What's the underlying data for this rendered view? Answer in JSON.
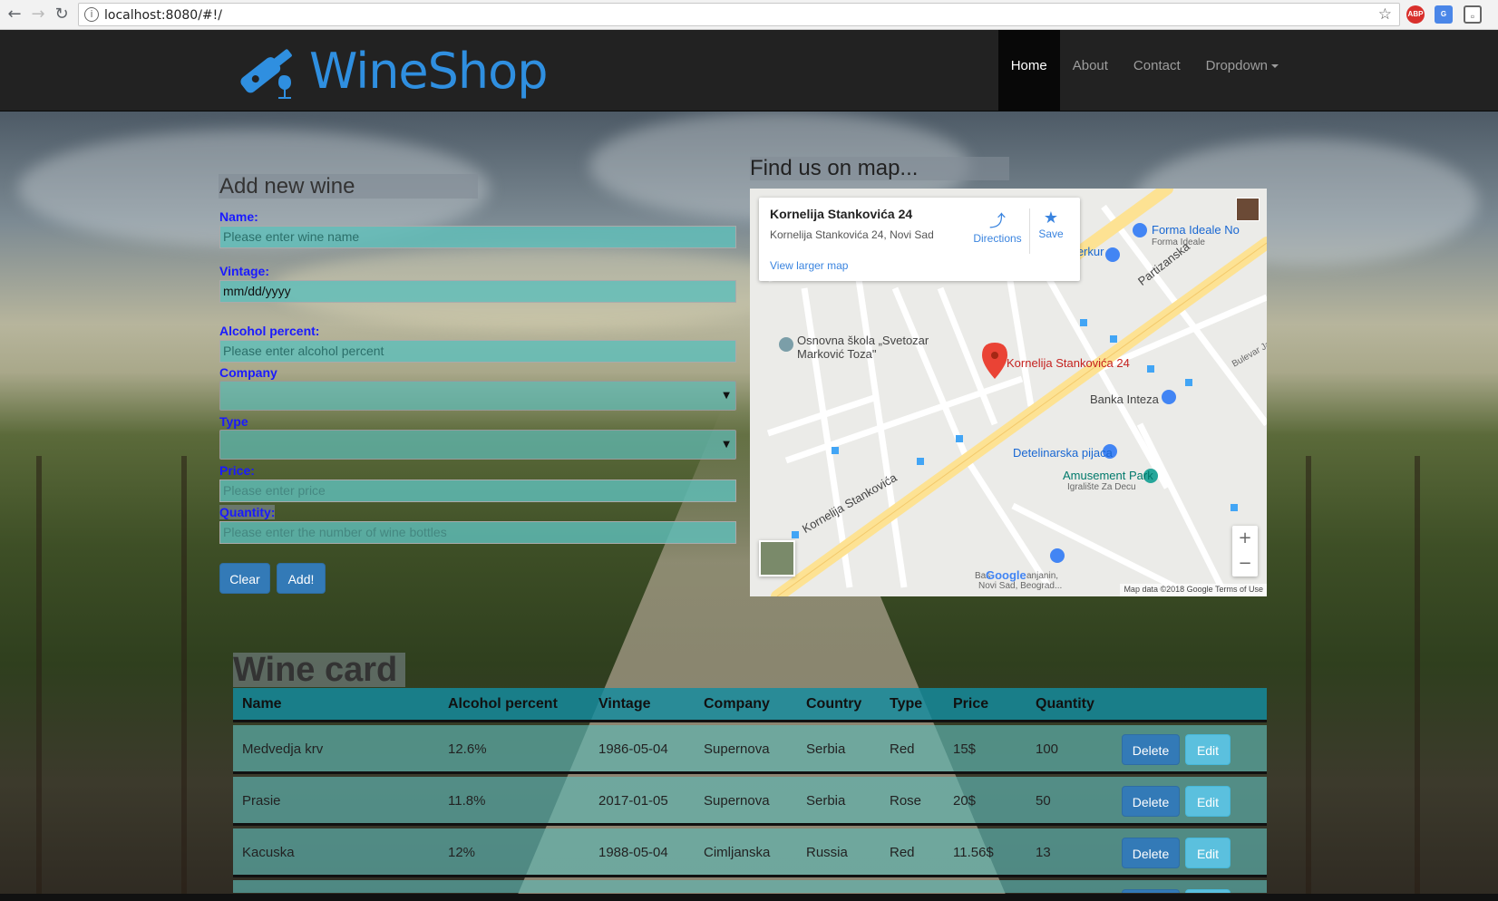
{
  "browser": {
    "url": "localhost:8080/#!/",
    "extensions": [
      "ABP",
      "G"
    ]
  },
  "navbar": {
    "brand": "WineShop",
    "items": [
      {
        "label": "Home",
        "active": true
      },
      {
        "label": "About"
      },
      {
        "label": "Contact"
      },
      {
        "label": "Dropdown"
      }
    ]
  },
  "form": {
    "title": "Add new wine",
    "name_label": "Name:",
    "name_placeholder": "Please enter wine name",
    "vintage_label": "Vintage:",
    "vintage_value": "mm/dd/yyyy",
    "alcohol_label": "Alcohol percent:",
    "alcohol_placeholder": "Please enter alcohol percent",
    "company_label": "Company",
    "type_label": "Type",
    "price_label": "Price:",
    "price_placeholder": "Please enter price",
    "quantity_label": "Quantity:",
    "quantity_placeholder": "Please enter the number of wine bottles",
    "clear_label": "Clear",
    "add_label": "Add!"
  },
  "map": {
    "title": "Find us on map...",
    "place_name": "Kornelija Stankovića 24",
    "place_address": "Kornelija Stankovića 24, Novi Sad",
    "directions_label": "Directions",
    "save_label": "Save",
    "larger_map_label": "View larger map",
    "pin_label": "Kornelija Stankovića 24",
    "footer": "Map data ©2018 Google   Terms of Use",
    "google": "Google",
    "labels": {
      "school": "Osnovna škola „Svetozar",
      "school2": "Marković Toza\"",
      "merkur": "Merkur",
      "forma": "Forma Ideale No",
      "forma_sub": "Forma Ideale",
      "banka": "Banka Inteza",
      "pijaca": "Detelinarska pijaca",
      "park": "Amusement Park",
      "park_sub": "Igralište Za Decu",
      "partizanska": "Partizanska",
      "kornelija_street": "Kornelija Stankovića",
      "bulevar": "Bulevar Ja",
      "basta": "Bas",
      "basta2": "anjanin,",
      "basta3": "Novi Sad, Beograd..."
    }
  },
  "table": {
    "title": "Wine card",
    "headers": [
      "Name",
      "Alcohol percent",
      "Vintage",
      "Company",
      "Country",
      "Type",
      "Price",
      "Quantity"
    ],
    "rows": [
      {
        "name": "Medvedja krv",
        "alcohol": "12.6%",
        "vintage": "1986-05-04",
        "company": "Supernova",
        "country": "Serbia",
        "type": "Red",
        "price": "15$",
        "quantity": "100"
      },
      {
        "name": "Prasie",
        "alcohol": "11.8%",
        "vintage": "2017-01-05",
        "company": "Supernova",
        "country": "Serbia",
        "type": "Rose",
        "price": "20$",
        "quantity": "50"
      },
      {
        "name": "Kacuska",
        "alcohol": "12%",
        "vintage": "1988-05-04",
        "company": "Cimljanska",
        "country": "Russia",
        "type": "Red",
        "price": "11.56$",
        "quantity": "13"
      }
    ],
    "delete_label": "Delete",
    "edit_label": "Edit"
  },
  "colors": {
    "brand": "#2f8fe0",
    "primary": "#337ab7",
    "info": "#5bc0de",
    "navbar": "#222222"
  }
}
